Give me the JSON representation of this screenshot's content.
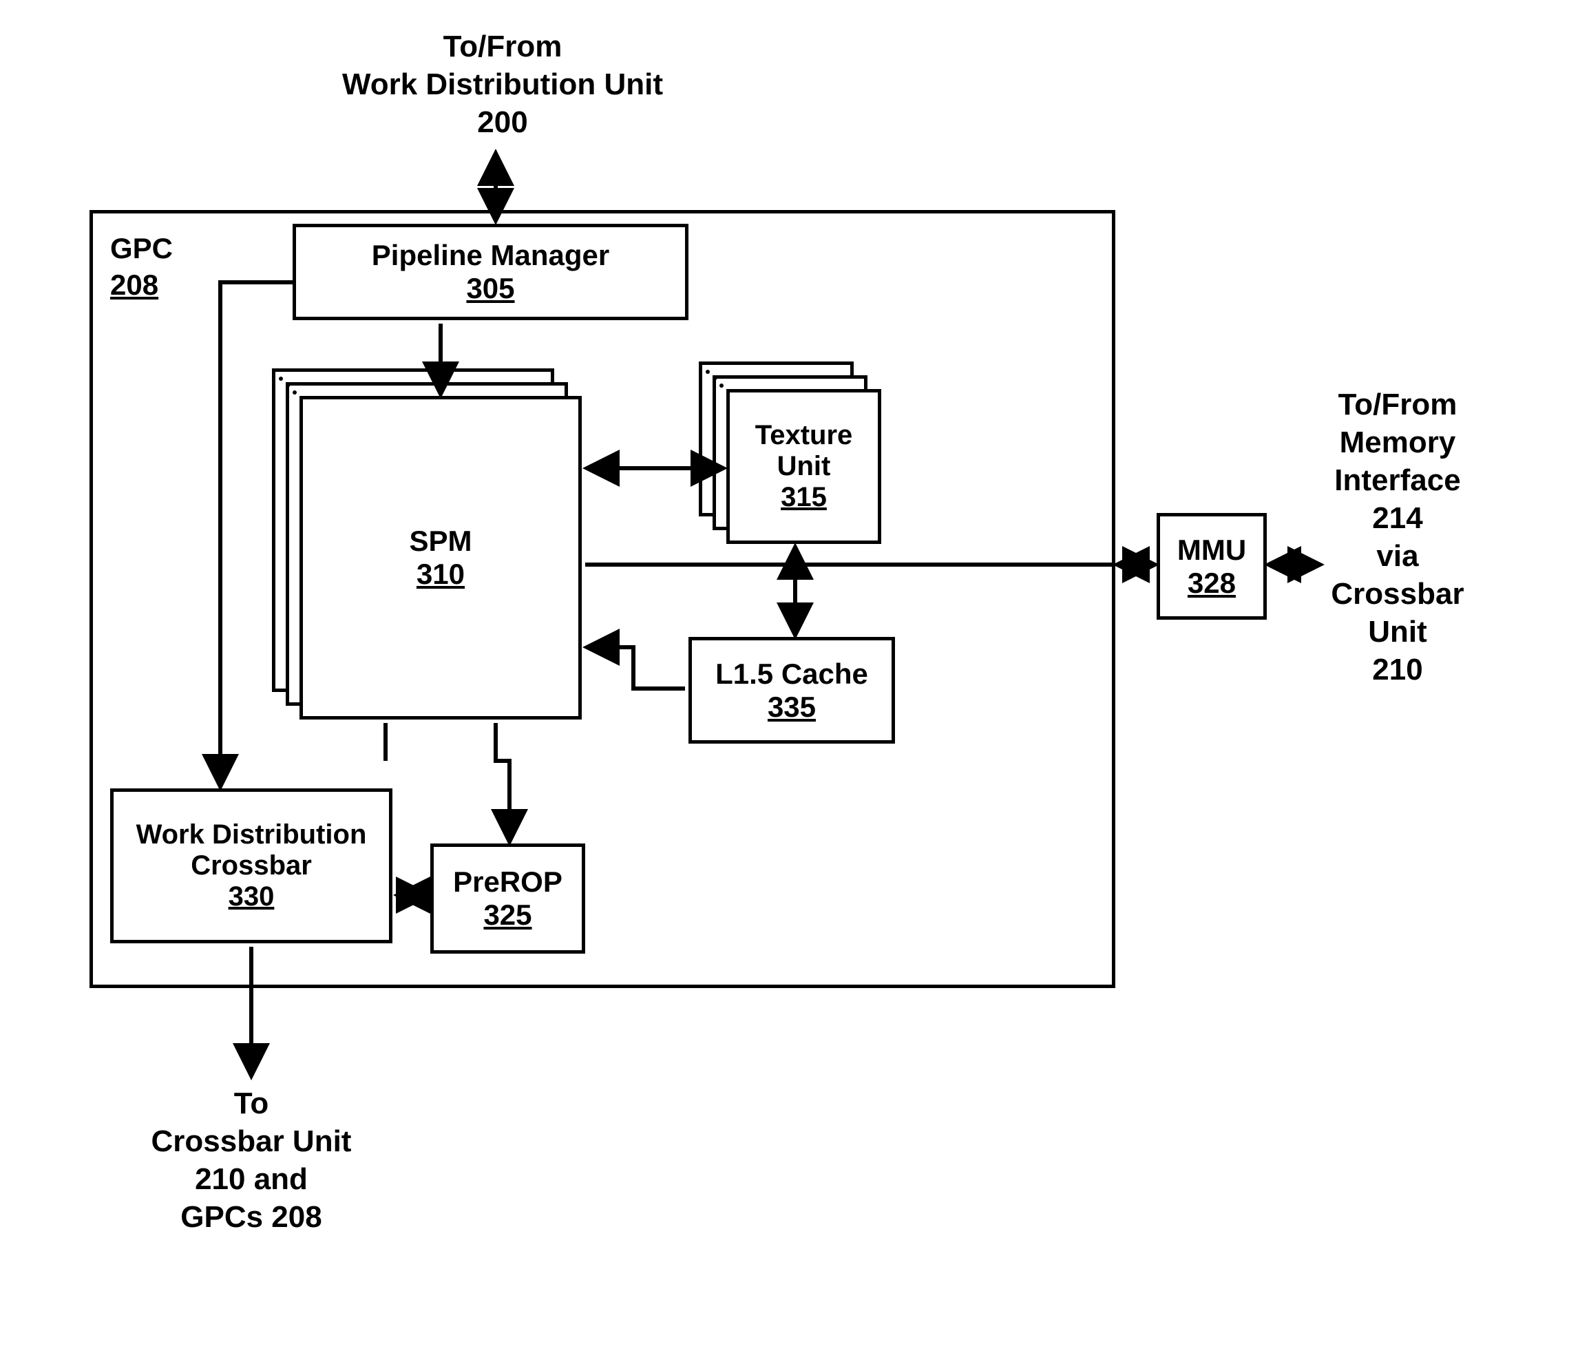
{
  "top": {
    "line1": "To/From",
    "line2": "Work Distribution Unit",
    "num": "200"
  },
  "gpc": {
    "label": "GPC",
    "num": "208"
  },
  "pipeline": {
    "label": "Pipeline Manager",
    "num": "305"
  },
  "spm": {
    "label": "SPM",
    "num": "310"
  },
  "texture": {
    "line1": "Texture",
    "line2": "Unit",
    "num": "315"
  },
  "cache": {
    "label": "L1.5 Cache",
    "num": "335"
  },
  "wdx": {
    "line1": "Work Distribution",
    "line2": "Crossbar",
    "num": "330"
  },
  "prerop": {
    "label": "PreROP",
    "num": "325"
  },
  "mmu": {
    "label": "MMU",
    "num": "328"
  },
  "right": {
    "line1": "To/From",
    "line2": "Memory",
    "line3": "Interface",
    "line4": "214",
    "line5": "via",
    "line6": "Crossbar",
    "line7": "Unit",
    "line8": "210"
  },
  "bottom": {
    "line1": "To",
    "line2": "Crossbar Unit",
    "line3": "210 and",
    "line4": "GPCs 208"
  }
}
